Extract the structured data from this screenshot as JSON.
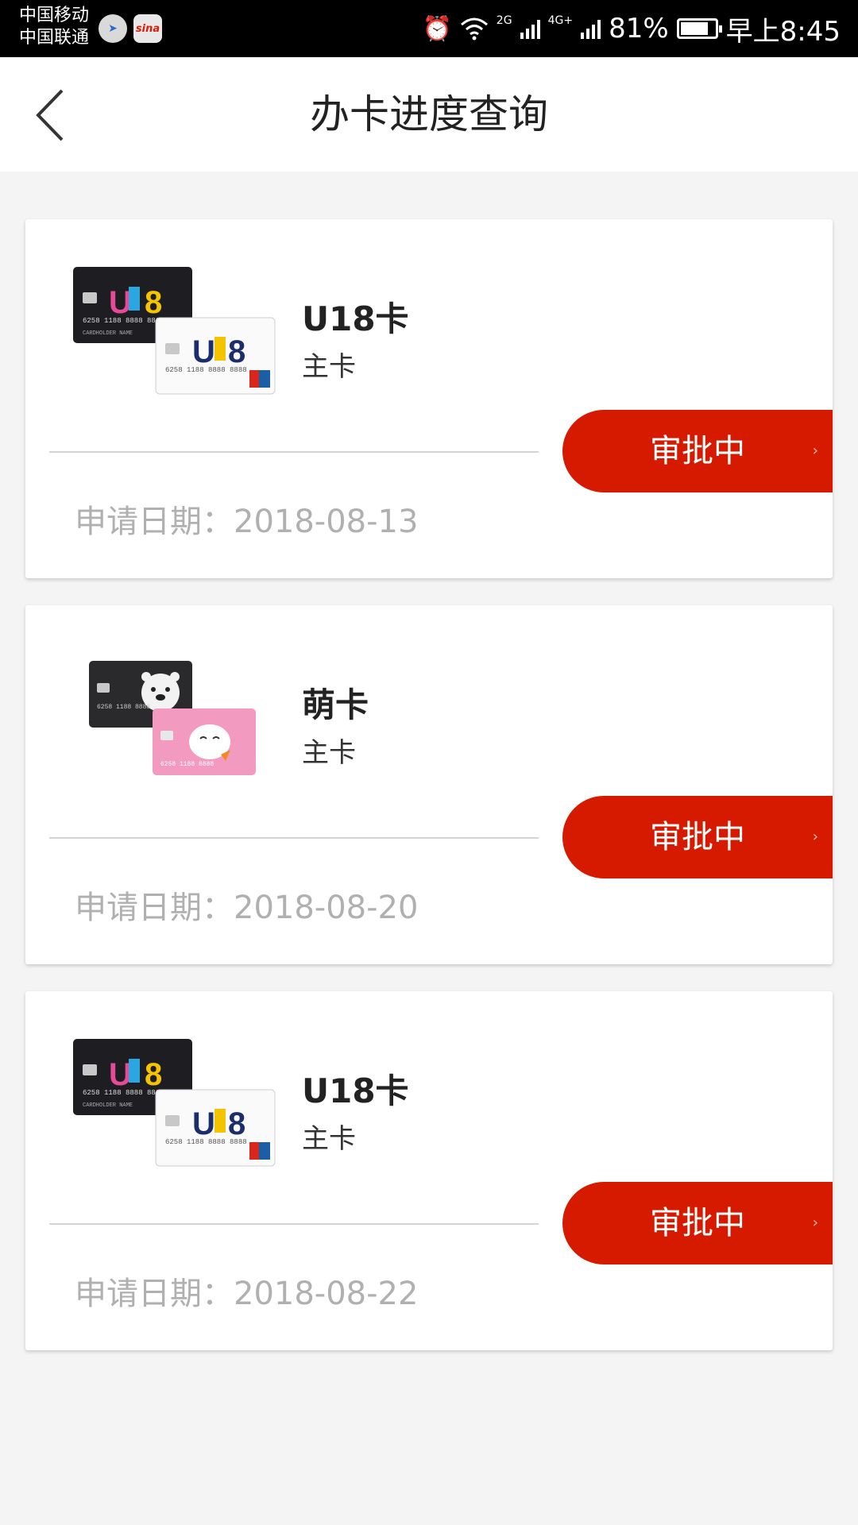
{
  "status_bar": {
    "carrier_1": "中国移动",
    "carrier_2": "中国联通",
    "sina_label": "sina",
    "net_2g": "2G",
    "net_4g": "4G+",
    "battery": "81%",
    "battery_level": 0.81,
    "time": "早上8:45"
  },
  "header": {
    "title": "办卡进度查询"
  },
  "applications": [
    {
      "card_name": "U18卡",
      "card_type": "主卡",
      "status": "审批中",
      "date": "申请日期：2018-08-13"
    },
    {
      "card_name": "萌卡",
      "card_type": "主卡",
      "status": "审批中",
      "date": "申请日期：2018-08-20"
    },
    {
      "card_name": "U18卡",
      "card_type": "主卡",
      "status": "审批中",
      "date": "申请日期：2018-08-22"
    }
  ],
  "icons": {
    "back": "chevron-left-icon",
    "status_chevron": "›"
  },
  "colors": {
    "accent": "#d51a00",
    "date_text": "#b0b0b0",
    "page_bg": "#f4f4f4"
  }
}
